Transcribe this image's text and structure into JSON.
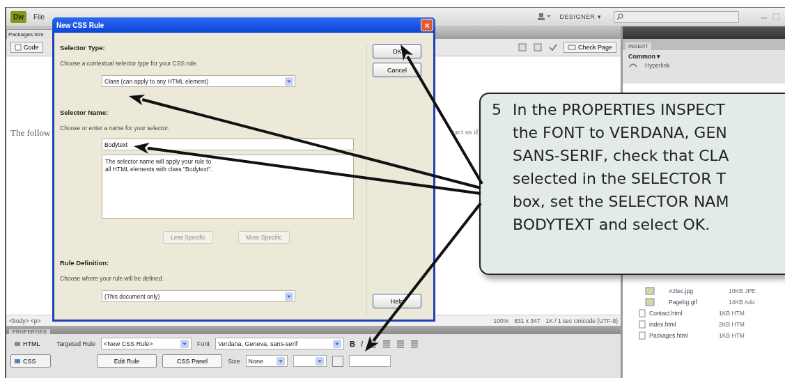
{
  "app": {
    "logo": "Dw",
    "menu": [
      "File"
    ],
    "workspace": "DESIGNER",
    "workspace_caret": "▾"
  },
  "document": {
    "tab": "Packages.htm",
    "code_button": "Code",
    "check_page": "Check Page",
    "body_text_left": "The follow",
    "body_text_right": "tact us if"
  },
  "status_bar": {
    "tags": [
      "<body>",
      "<p>"
    ],
    "zoom": "100%",
    "size": "831 x 347",
    "info": "1K / 1 sec  Unicode (UTF-8)"
  },
  "insert_panel": {
    "title": "INSERT",
    "category": "Common",
    "category_caret": "▾",
    "items": [
      "Hyperlink"
    ]
  },
  "files": [
    {
      "name": "Aztec.jpg",
      "info": "10KB JPE",
      "kind": "image"
    },
    {
      "name": "Pagebg.gif",
      "info": "14KB Ado",
      "kind": "image"
    },
    {
      "name": "Contact.html",
      "info": "1KB HTM",
      "kind": "page"
    },
    {
      "name": "index.html",
      "info": "2KB HTM",
      "kind": "page"
    },
    {
      "name": "Packages.html",
      "info": "1KB HTM",
      "kind": "page"
    }
  ],
  "properties": {
    "title": "PROPERTIES",
    "modes": [
      {
        "label": "HTML",
        "selected": false
      },
      {
        "label": "CSS",
        "selected": true
      }
    ],
    "targeted_rule_label": "Targeted Rule",
    "targeted_rule": "<New CSS Rule>",
    "edit_rule": "Edit Rule",
    "css_panel": "CSS Panel",
    "font_label": "Font",
    "font": "Verdana, Geneva, sans-serif",
    "size_label": "Size",
    "size": "None",
    "bold": "B",
    "italic": "I"
  },
  "dialog": {
    "title": "New CSS Rule",
    "close": "×",
    "selector_type": {
      "heading": "Selector Type:",
      "hint": "Choose a contextual selector type for your CSS rule.",
      "value": "Class (can apply to any HTML element)"
    },
    "selector_name": {
      "heading": "Selector Name:",
      "hint": "Choose or enter a name for your selector.",
      "value": "Bodytext",
      "description": "The selector name will apply your rule to\nall HTML elements with class \"Bodytext\".",
      "buttons": [
        {
          "label": "Less Specific",
          "disabled": true
        },
        {
          "label": "More Specific",
          "disabled": true
        }
      ]
    },
    "rule_definition": {
      "heading": "Rule Definition:",
      "hint": "Choose where your rule will be defined.",
      "value": "(This document only)"
    },
    "buttons": [
      "OK",
      "Cancel",
      "Help"
    ]
  },
  "callout": {
    "number": "5",
    "lines": [
      "In the PROPERTIES INSPECT",
      "the FONT to VERDANA, GEN",
      "SANS-SERIF, check that CLA",
      "selected in the SELECTOR T",
      "box, set the SELECTOR NAM",
      "BODYTEXT and select OK."
    ]
  }
}
